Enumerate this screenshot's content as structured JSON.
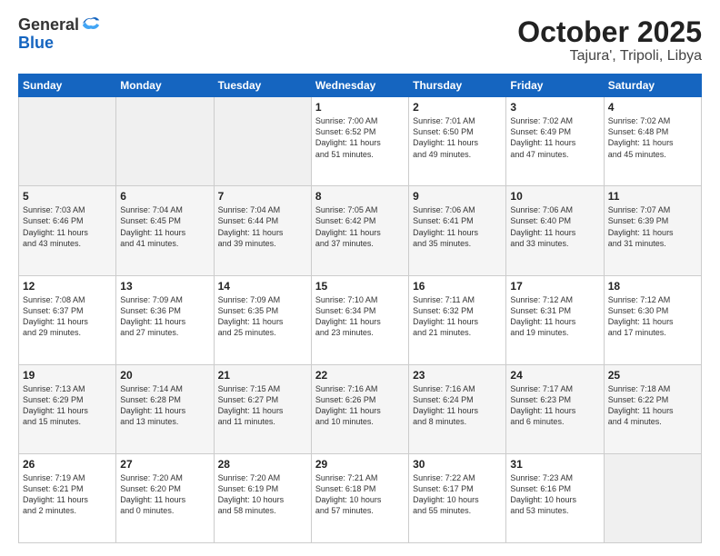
{
  "header": {
    "logo_general": "General",
    "logo_blue": "Blue",
    "title": "October 2025",
    "subtitle": "Tajura', Tripoli, Libya"
  },
  "weekdays": [
    "Sunday",
    "Monday",
    "Tuesday",
    "Wednesday",
    "Thursday",
    "Friday",
    "Saturday"
  ],
  "weeks": [
    [
      {
        "day": "",
        "info": ""
      },
      {
        "day": "",
        "info": ""
      },
      {
        "day": "",
        "info": ""
      },
      {
        "day": "1",
        "info": "Sunrise: 7:00 AM\nSunset: 6:52 PM\nDaylight: 11 hours\nand 51 minutes."
      },
      {
        "day": "2",
        "info": "Sunrise: 7:01 AM\nSunset: 6:50 PM\nDaylight: 11 hours\nand 49 minutes."
      },
      {
        "day": "3",
        "info": "Sunrise: 7:02 AM\nSunset: 6:49 PM\nDaylight: 11 hours\nand 47 minutes."
      },
      {
        "day": "4",
        "info": "Sunrise: 7:02 AM\nSunset: 6:48 PM\nDaylight: 11 hours\nand 45 minutes."
      }
    ],
    [
      {
        "day": "5",
        "info": "Sunrise: 7:03 AM\nSunset: 6:46 PM\nDaylight: 11 hours\nand 43 minutes."
      },
      {
        "day": "6",
        "info": "Sunrise: 7:04 AM\nSunset: 6:45 PM\nDaylight: 11 hours\nand 41 minutes."
      },
      {
        "day": "7",
        "info": "Sunrise: 7:04 AM\nSunset: 6:44 PM\nDaylight: 11 hours\nand 39 minutes."
      },
      {
        "day": "8",
        "info": "Sunrise: 7:05 AM\nSunset: 6:42 PM\nDaylight: 11 hours\nand 37 minutes."
      },
      {
        "day": "9",
        "info": "Sunrise: 7:06 AM\nSunset: 6:41 PM\nDaylight: 11 hours\nand 35 minutes."
      },
      {
        "day": "10",
        "info": "Sunrise: 7:06 AM\nSunset: 6:40 PM\nDaylight: 11 hours\nand 33 minutes."
      },
      {
        "day": "11",
        "info": "Sunrise: 7:07 AM\nSunset: 6:39 PM\nDaylight: 11 hours\nand 31 minutes."
      }
    ],
    [
      {
        "day": "12",
        "info": "Sunrise: 7:08 AM\nSunset: 6:37 PM\nDaylight: 11 hours\nand 29 minutes."
      },
      {
        "day": "13",
        "info": "Sunrise: 7:09 AM\nSunset: 6:36 PM\nDaylight: 11 hours\nand 27 minutes."
      },
      {
        "day": "14",
        "info": "Sunrise: 7:09 AM\nSunset: 6:35 PM\nDaylight: 11 hours\nand 25 minutes."
      },
      {
        "day": "15",
        "info": "Sunrise: 7:10 AM\nSunset: 6:34 PM\nDaylight: 11 hours\nand 23 minutes."
      },
      {
        "day": "16",
        "info": "Sunrise: 7:11 AM\nSunset: 6:32 PM\nDaylight: 11 hours\nand 21 minutes."
      },
      {
        "day": "17",
        "info": "Sunrise: 7:12 AM\nSunset: 6:31 PM\nDaylight: 11 hours\nand 19 minutes."
      },
      {
        "day": "18",
        "info": "Sunrise: 7:12 AM\nSunset: 6:30 PM\nDaylight: 11 hours\nand 17 minutes."
      }
    ],
    [
      {
        "day": "19",
        "info": "Sunrise: 7:13 AM\nSunset: 6:29 PM\nDaylight: 11 hours\nand 15 minutes."
      },
      {
        "day": "20",
        "info": "Sunrise: 7:14 AM\nSunset: 6:28 PM\nDaylight: 11 hours\nand 13 minutes."
      },
      {
        "day": "21",
        "info": "Sunrise: 7:15 AM\nSunset: 6:27 PM\nDaylight: 11 hours\nand 11 minutes."
      },
      {
        "day": "22",
        "info": "Sunrise: 7:16 AM\nSunset: 6:26 PM\nDaylight: 11 hours\nand 10 minutes."
      },
      {
        "day": "23",
        "info": "Sunrise: 7:16 AM\nSunset: 6:24 PM\nDaylight: 11 hours\nand 8 minutes."
      },
      {
        "day": "24",
        "info": "Sunrise: 7:17 AM\nSunset: 6:23 PM\nDaylight: 11 hours\nand 6 minutes."
      },
      {
        "day": "25",
        "info": "Sunrise: 7:18 AM\nSunset: 6:22 PM\nDaylight: 11 hours\nand 4 minutes."
      }
    ],
    [
      {
        "day": "26",
        "info": "Sunrise: 7:19 AM\nSunset: 6:21 PM\nDaylight: 11 hours\nand 2 minutes."
      },
      {
        "day": "27",
        "info": "Sunrise: 7:20 AM\nSunset: 6:20 PM\nDaylight: 11 hours\nand 0 minutes."
      },
      {
        "day": "28",
        "info": "Sunrise: 7:20 AM\nSunset: 6:19 PM\nDaylight: 10 hours\nand 58 minutes."
      },
      {
        "day": "29",
        "info": "Sunrise: 7:21 AM\nSunset: 6:18 PM\nDaylight: 10 hours\nand 57 minutes."
      },
      {
        "day": "30",
        "info": "Sunrise: 7:22 AM\nSunset: 6:17 PM\nDaylight: 10 hours\nand 55 minutes."
      },
      {
        "day": "31",
        "info": "Sunrise: 7:23 AM\nSunset: 6:16 PM\nDaylight: 10 hours\nand 53 minutes."
      },
      {
        "day": "",
        "info": ""
      }
    ]
  ]
}
